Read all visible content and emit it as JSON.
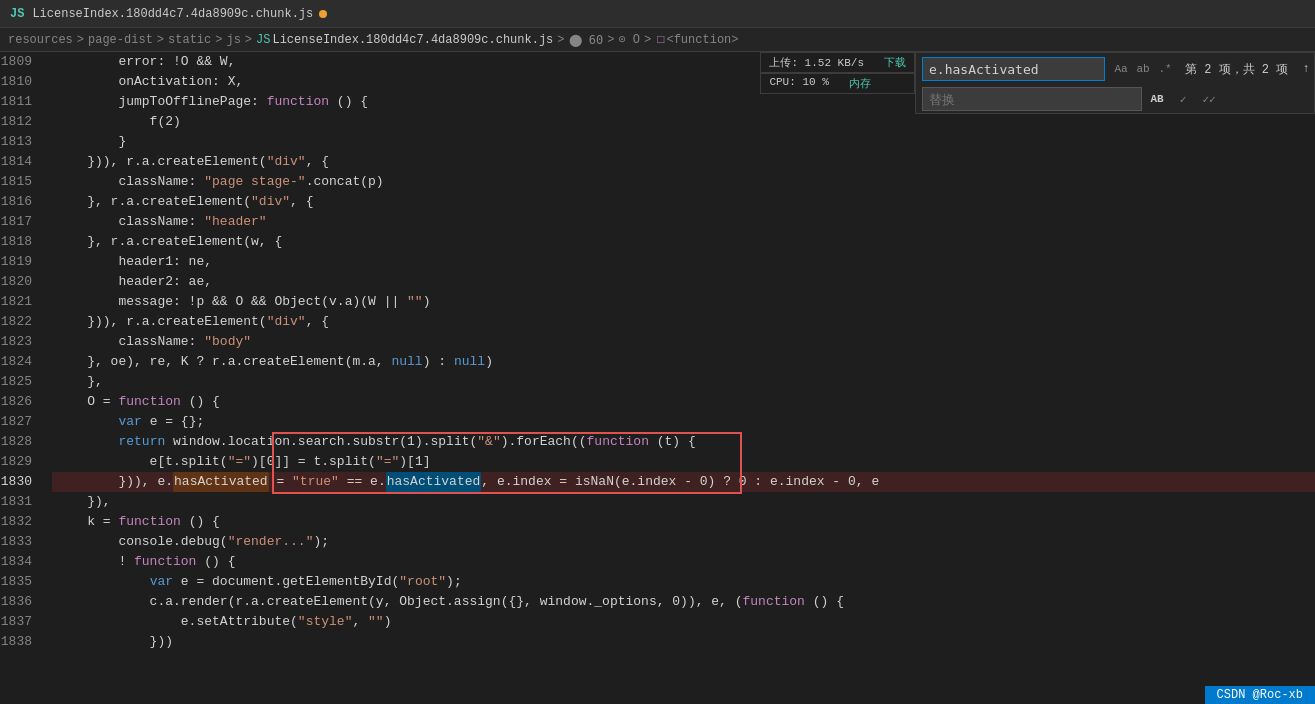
{
  "title": "LicenseIndex.180dd4c7.4da8909c.chunk.js",
  "modified": true,
  "breadcrumb": {
    "parts": [
      "resources",
      "page-dist",
      "static",
      "js",
      "LicenseIndex.180dd4c7.4da8909c.chunk.js"
    ],
    "extras": [
      "60",
      "O",
      "<function>"
    ]
  },
  "search": {
    "query": "e.hasActivated",
    "replace": "替换",
    "count_text": "第 2 项，共 2 项",
    "icons": [
      "Aa",
      "ab",
      ".*"
    ]
  },
  "perf": {
    "upload": "上传: 1.52 KB/s",
    "download": "下载",
    "cpu": "CPU: 10 %",
    "memory": "内存"
  },
  "lines": [
    {
      "num": 1809,
      "tokens": [
        {
          "t": "        error: !O && W,",
          "c": ""
        }
      ]
    },
    {
      "num": 1810,
      "tokens": [
        {
          "t": "        onActivation: X,",
          "c": ""
        }
      ]
    },
    {
      "num": 1811,
      "tokens": [
        {
          "t": "        jumpToOfflinePage: ",
          "c": ""
        },
        {
          "t": "function",
          "c": "kw2"
        },
        {
          "t": " () {",
          "c": ""
        }
      ]
    },
    {
      "num": 1812,
      "tokens": [
        {
          "t": "            f(2)",
          "c": ""
        }
      ]
    },
    {
      "num": 1813,
      "tokens": [
        {
          "t": "        }",
          "c": ""
        }
      ]
    },
    {
      "num": 1814,
      "tokens": [
        {
          "t": "    })), r.a.createElement(",
          "c": ""
        },
        {
          "t": "\"div\"",
          "c": "str"
        },
        {
          "t": ", {",
          "c": ""
        }
      ]
    },
    {
      "num": 1815,
      "tokens": [
        {
          "t": "        className: ",
          "c": ""
        },
        {
          "t": "\"page stage-\"",
          "c": "str"
        },
        {
          "t": ".concat(p)",
          "c": ""
        }
      ]
    },
    {
      "num": 1816,
      "tokens": [
        {
          "t": "    }, r.a.createElement(",
          "c": ""
        },
        {
          "t": "\"div\"",
          "c": "str"
        },
        {
          "t": ", {",
          "c": ""
        }
      ]
    },
    {
      "num": 1817,
      "tokens": [
        {
          "t": "        className: ",
          "c": ""
        },
        {
          "t": "\"header\"",
          "c": "str"
        }
      ]
    },
    {
      "num": 1818,
      "tokens": [
        {
          "t": "    }, r.a.createElement(w, {",
          "c": ""
        }
      ]
    },
    {
      "num": 1819,
      "tokens": [
        {
          "t": "        header1: ne,",
          "c": ""
        }
      ]
    },
    {
      "num": 1820,
      "tokens": [
        {
          "t": "        header2: ae,",
          "c": ""
        }
      ]
    },
    {
      "num": 1821,
      "tokens": [
        {
          "t": "        message: !p && O && Object(v.a)(W || ",
          "c": ""
        },
        {
          "t": "\"\"",
          "c": "str"
        },
        {
          "t": ")",
          "c": ""
        }
      ]
    },
    {
      "num": 1822,
      "tokens": [
        {
          "t": "    })), r.a.createElement(",
          "c": ""
        },
        {
          "t": "\"div\"",
          "c": "str"
        },
        {
          "t": ", {",
          "c": ""
        }
      ]
    },
    {
      "num": 1823,
      "tokens": [
        {
          "t": "        className: ",
          "c": ""
        },
        {
          "t": "\"body\"",
          "c": "str"
        }
      ]
    },
    {
      "num": 1824,
      "tokens": [
        {
          "t": "    }, oe), re, K ? r.a.createElement(m.a, ",
          "c": ""
        },
        {
          "t": "null",
          "c": "bool"
        },
        {
          "t": ") : ",
          "c": ""
        },
        {
          "t": "null",
          "c": "bool"
        },
        {
          "t": ")",
          "c": ""
        }
      ]
    },
    {
      "num": 1825,
      "tokens": [
        {
          "t": "    },",
          "c": ""
        }
      ]
    },
    {
      "num": 1826,
      "tokens": [
        {
          "t": "    O = ",
          "c": ""
        },
        {
          "t": "function",
          "c": "kw2"
        },
        {
          "t": " () {",
          "c": ""
        }
      ]
    },
    {
      "num": 1827,
      "tokens": [
        {
          "t": "        ",
          "c": ""
        },
        {
          "t": "var",
          "c": "kw"
        },
        {
          "t": " e = {};",
          "c": ""
        }
      ]
    },
    {
      "num": 1828,
      "tokens": [
        {
          "t": "        ",
          "c": ""
        },
        {
          "t": "return",
          "c": "kw"
        },
        {
          "t": " window.location.search.substr(1).split(",
          "c": ""
        },
        {
          "t": "\"&\"",
          "c": "str"
        },
        {
          "t": ").forEach((",
          "c": ""
        },
        {
          "t": "function",
          "c": "kw2"
        },
        {
          "t": " (t) {",
          "c": ""
        }
      ]
    },
    {
      "num": 1829,
      "tokens": [
        {
          "t": "            e[t.split(",
          "c": ""
        },
        {
          "t": "\"=\"",
          "c": "str"
        },
        {
          "t": ")[0]] = t.split(",
          "c": ""
        },
        {
          "t": "\"=\"",
          "c": "str"
        },
        {
          "t": ")[1]",
          "c": ""
        }
      ]
    },
    {
      "num": 1830,
      "tokens": [
        {
          "t": "        })), e.",
          "c": ""
        },
        {
          "t": "hasActivated",
          "c": "search-highlight-text"
        },
        {
          "t": " = ",
          "c": ""
        },
        {
          "t": "\"true\"",
          "c": "str"
        },
        {
          "t": " == e.",
          "c": ""
        },
        {
          "t": "hasActivated",
          "c": "search-current-text"
        },
        {
          "t": ", e.index = isNaN(e.index - 0) ? 0 : e.index - 0, e",
          "c": ""
        }
      ],
      "lightbulb": true
    },
    {
      "num": 1831,
      "tokens": [
        {
          "t": "    }),",
          "c": ""
        }
      ]
    },
    {
      "num": 1832,
      "tokens": [
        {
          "t": "    k = ",
          "c": ""
        },
        {
          "t": "function",
          "c": "kw2"
        },
        {
          "t": " () {",
          "c": ""
        }
      ]
    },
    {
      "num": 1833,
      "tokens": [
        {
          "t": "        console.debug(",
          "c": ""
        },
        {
          "t": "\"render...\"",
          "c": "str"
        },
        {
          "t": ");",
          "c": ""
        }
      ]
    },
    {
      "num": 1834,
      "tokens": [
        {
          "t": "        ! ",
          "c": ""
        },
        {
          "t": "function",
          "c": "kw2"
        },
        {
          "t": " () {",
          "c": ""
        }
      ]
    },
    {
      "num": 1835,
      "tokens": [
        {
          "t": "            ",
          "c": ""
        },
        {
          "t": "var",
          "c": "kw"
        },
        {
          "t": " e = document.getElementById(",
          "c": ""
        },
        {
          "t": "\"root\"",
          "c": "str"
        },
        {
          "t": ");",
          "c": ""
        }
      ]
    },
    {
      "num": 1836,
      "tokens": [
        {
          "t": "            c.a.render(r.a.createElement(y, Object.assign({}, window._options, 0)), e, (",
          "c": ""
        },
        {
          "t": "function",
          "c": "kw2"
        },
        {
          "t": " () {",
          "c": ""
        }
      ]
    },
    {
      "num": 1837,
      "tokens": [
        {
          "t": "                e.setAttribute(",
          "c": ""
        },
        {
          "t": "\"style\"",
          "c": "str"
        },
        {
          "t": ", ",
          "c": ""
        },
        {
          "t": "\"\"",
          "c": "str"
        },
        {
          "t": ")",
          "c": ""
        }
      ]
    },
    {
      "num": 1838,
      "tokens": [
        {
          "t": "            }))",
          "c": ""
        }
      ]
    }
  ],
  "status": {
    "text": "CSDN @Roc-xb"
  }
}
